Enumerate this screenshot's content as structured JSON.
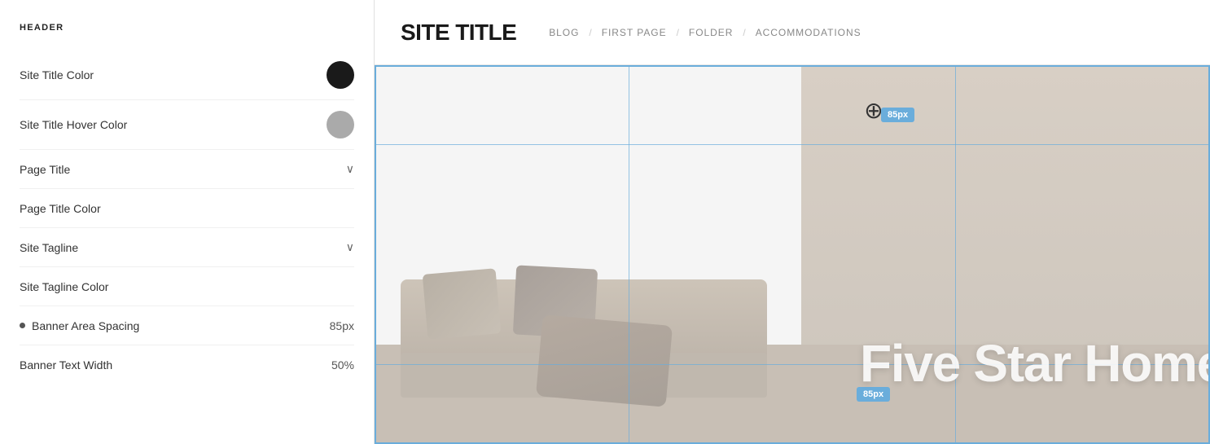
{
  "leftPanel": {
    "sectionHeader": "HEADER",
    "settings": [
      {
        "id": "site-title-color",
        "label": "Site Title Color",
        "type": "color",
        "swatchClass": "swatch-black",
        "hasBullet": false
      },
      {
        "id": "site-title-hover-color",
        "label": "Site Title Hover Color",
        "type": "color",
        "swatchClass": "swatch-gray",
        "hasBullet": false
      },
      {
        "id": "page-title",
        "label": "Page Title",
        "type": "dropdown",
        "hasBullet": false
      },
      {
        "id": "page-title-color",
        "label": "Page Title Color",
        "type": "none",
        "hasBullet": false
      },
      {
        "id": "site-tagline",
        "label": "Site Tagline",
        "type": "dropdown",
        "hasBullet": false
      },
      {
        "id": "site-tagline-color",
        "label": "Site Tagline Color",
        "type": "none",
        "hasBullet": false
      },
      {
        "id": "banner-area-spacing",
        "label": "Banner Area Spacing",
        "type": "value",
        "value": "85px",
        "hasBullet": true
      },
      {
        "id": "banner-text-width",
        "label": "Banner Text Width",
        "type": "value",
        "value": "50%",
        "hasBullet": false
      }
    ]
  },
  "preview": {
    "siteTitle": "SITE TITLE",
    "navLinks": [
      {
        "label": "BLOG"
      },
      {
        "label": "FIRST PAGE"
      },
      {
        "label": "FOLDER"
      },
      {
        "label": "ACCOMMODATIONS"
      }
    ],
    "bannerSpacingLabel1": "85px",
    "bannerSpacingLabel2": "85px",
    "bannerPageTitle": "Five Star Home"
  },
  "icons": {
    "chevron": "∨",
    "crosshairUnicode": "⊕"
  }
}
